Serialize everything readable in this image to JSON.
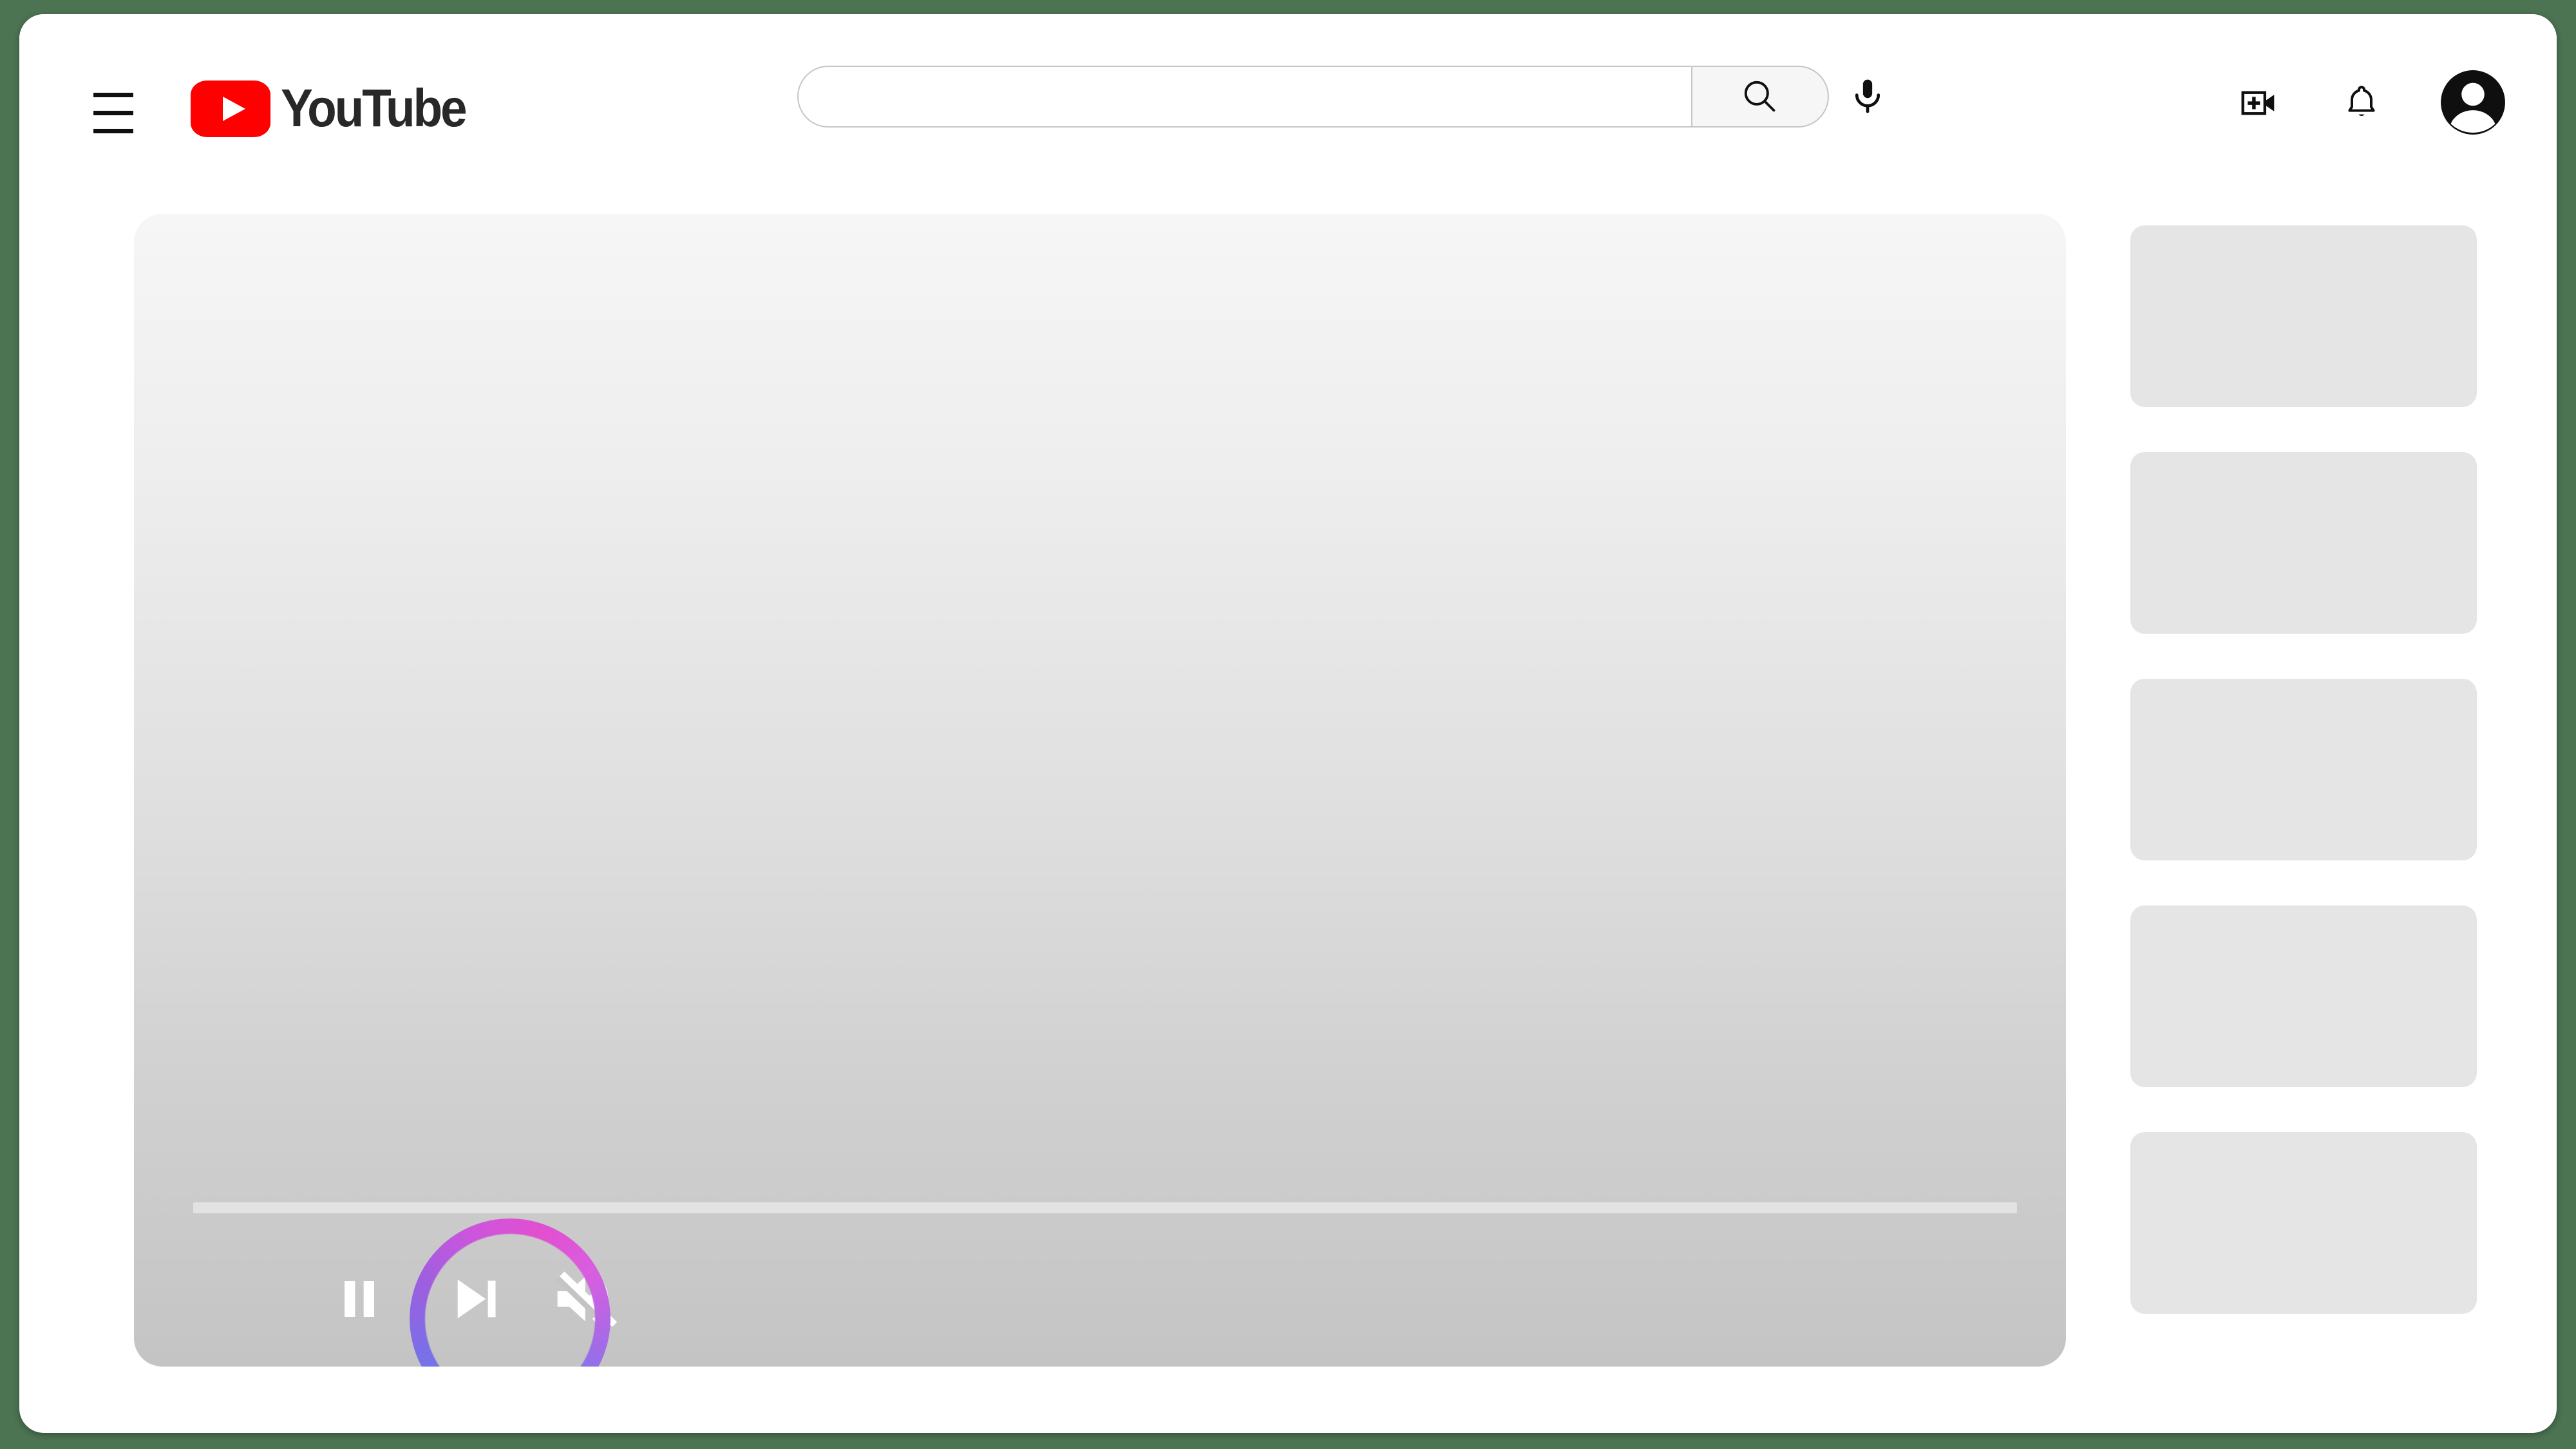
{
  "theme": {
    "page_background": "#4c7352",
    "card_background": "#ffffff",
    "brand_red": "#ff0000",
    "wordmark_color": "#282828",
    "icon_color": "#0f0f0f",
    "player_gradient_top": "#f6f6f6",
    "player_gradient_bottom": "#c4c4c4",
    "progress_track": "#e2e2e2",
    "placeholder_gray": "#e5e5e5",
    "highlight_ring_from": "#e24fd0",
    "highlight_ring_mid": "#9b5fe0",
    "highlight_ring_to": "#4a90e2"
  },
  "header": {
    "menu_button_name": "Guide",
    "logo": {
      "wordmark": "YouTube",
      "icon": "youtube-play-icon"
    },
    "search": {
      "value": "",
      "placeholder": "",
      "search_button_label": "Search",
      "search_icon": "magnifier-icon",
      "mic_button_label": "Search with your voice",
      "mic_icon": "microphone-icon"
    },
    "actions": [
      {
        "name": "create",
        "label": "Create",
        "icon": "video-camera-plus-icon"
      },
      {
        "name": "notifications",
        "label": "Notifications",
        "icon": "bell-icon"
      },
      {
        "name": "account",
        "label": "Account",
        "icon": "avatar-icon"
      }
    ]
  },
  "player": {
    "state": "playing",
    "muted": true,
    "progress_percent": 0,
    "controls": [
      {
        "name": "pause",
        "label": "Pause",
        "icon": "pause-icon",
        "highlighted": false
      },
      {
        "name": "next",
        "label": "Next",
        "icon": "next-track-icon",
        "highlighted": false
      },
      {
        "name": "mute",
        "label": "Unmute",
        "icon": "volume-muted-icon",
        "highlighted": true
      }
    ],
    "progress_label": "Seek slider"
  },
  "sidebar": {
    "items": [
      {
        "label": "",
        "name": "suggested-video-1"
      },
      {
        "label": "",
        "name": "suggested-video-2"
      },
      {
        "label": "",
        "name": "suggested-video-3"
      },
      {
        "label": "",
        "name": "suggested-video-4"
      },
      {
        "label": "",
        "name": "suggested-video-5"
      }
    ]
  }
}
